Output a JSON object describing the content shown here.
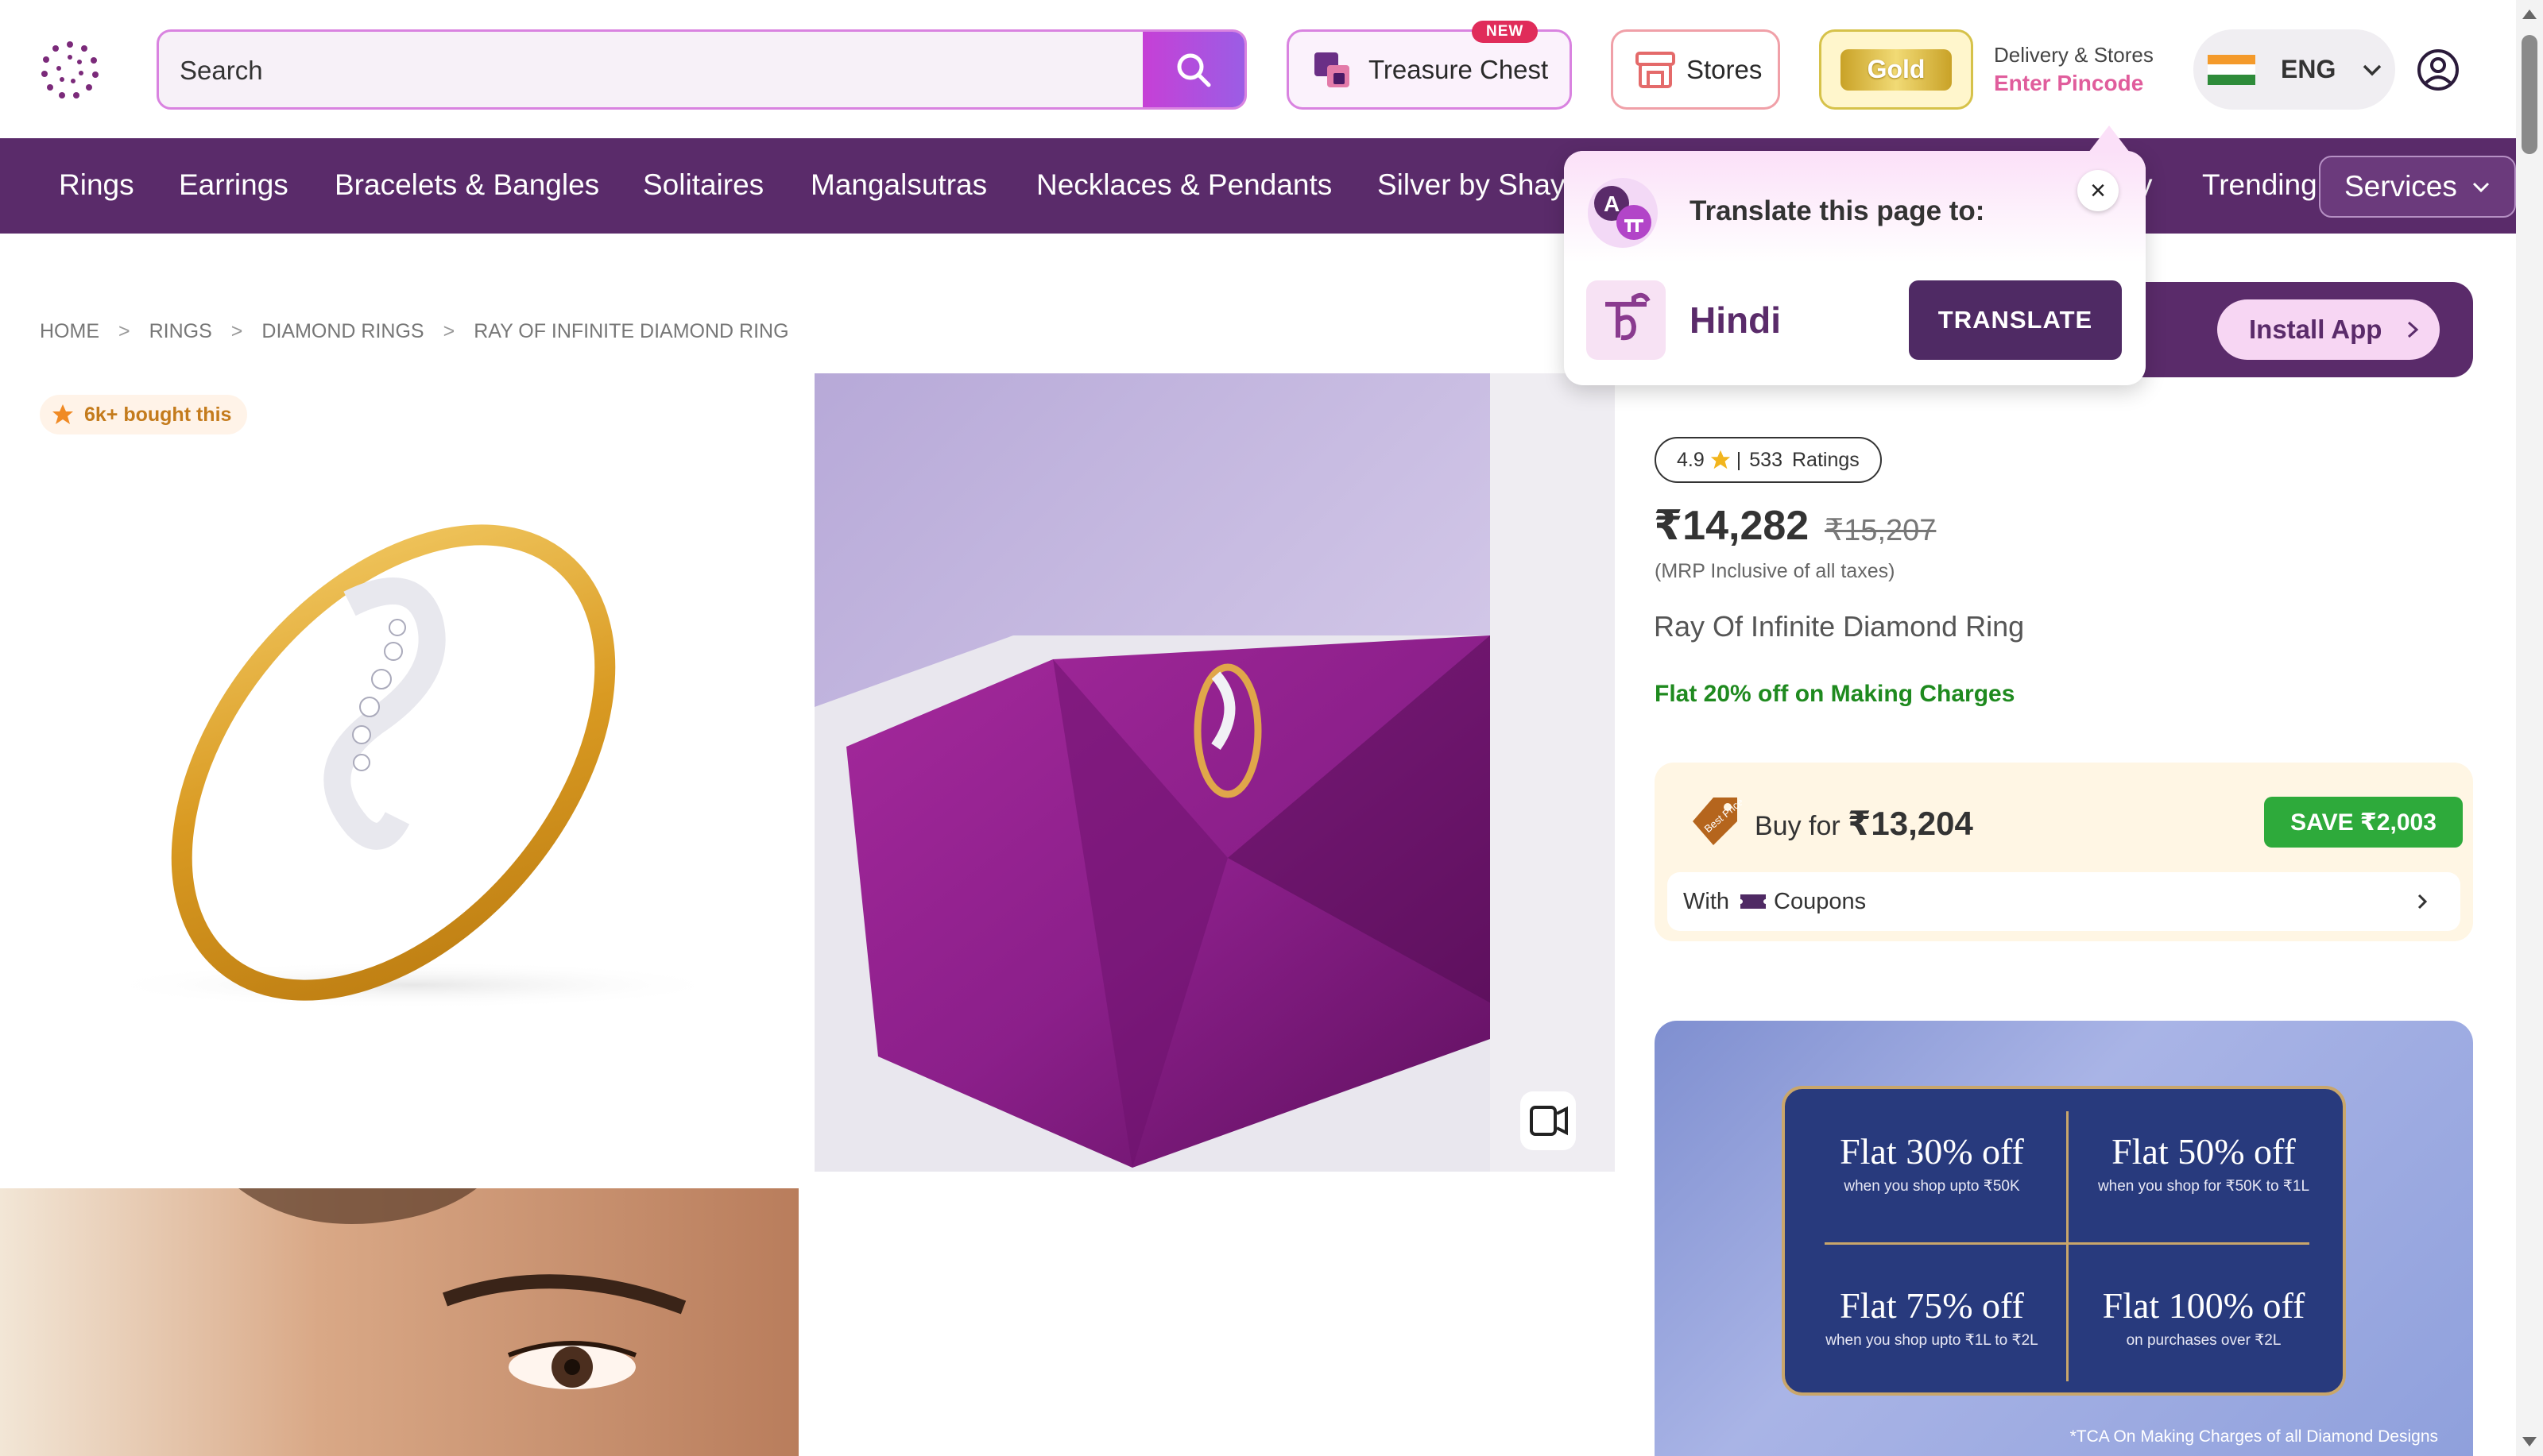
{
  "header": {
    "search_placeholder": "Search",
    "treasure_label": "Treasure Chest",
    "treasure_badge": "NEW",
    "stores_label": "Stores",
    "gold_label": "Gold",
    "delivery_title": "Delivery & Stores",
    "delivery_link": "Enter Pincode",
    "language": "ENG"
  },
  "nav": {
    "items": [
      "Rings",
      "Earrings",
      "Bracelets & Bangles",
      "Solitaires",
      "Mangalsutras",
      "Necklaces & Pendants",
      "Silver by Shay",
      "y",
      "Trending"
    ],
    "services": "Services"
  },
  "breadcrumb": [
    "HOME",
    "RINGS",
    "DIAMOND RINGS",
    "RAY OF INFINITE DIAMOND RING"
  ],
  "product": {
    "bought_badge": "6k+ bought this",
    "rating": "4.9",
    "ratings_count": "533",
    "ratings_label": "Ratings",
    "price": "₹14,282",
    "mrp": "₹15,207",
    "tax_note": "(MRP Inclusive of all taxes)",
    "name": "Ray Of Infinite Diamond Ring",
    "offer": "Flat 20% off on Making Charges"
  },
  "best_price": {
    "tag": "Best Price",
    "buy_for_label": "Buy for",
    "buy_for_price": "₹13,204",
    "save": "SAVE ₹2,003",
    "coupon_with": "With",
    "coupon_label": "Coupons"
  },
  "install": {
    "label": "Install App"
  },
  "promo": {
    "cells": [
      {
        "title": "Flat 30% off",
        "sub": "when you shop upto ₹50K"
      },
      {
        "title": "Flat 50% off",
        "sub": "when you shop for ₹50K to ₹1L"
      },
      {
        "title": "Flat 75% off",
        "sub": "when you shop upto ₹1L to ₹2L"
      },
      {
        "title": "Flat 100% off",
        "sub": "on purchases over ₹2L"
      }
    ],
    "tca": "*TCA On Making Charges of all Diamond Designs"
  },
  "translate_popup": {
    "title": "Translate this page to:",
    "language": "Hindi",
    "button": "TRANSLATE",
    "close": "×"
  },
  "colors": {
    "brand_purple": "#5a2b6a",
    "accent_pink": "#e05d9c",
    "save_green": "#2eaa3b",
    "offer_green": "#1f8a1f"
  }
}
